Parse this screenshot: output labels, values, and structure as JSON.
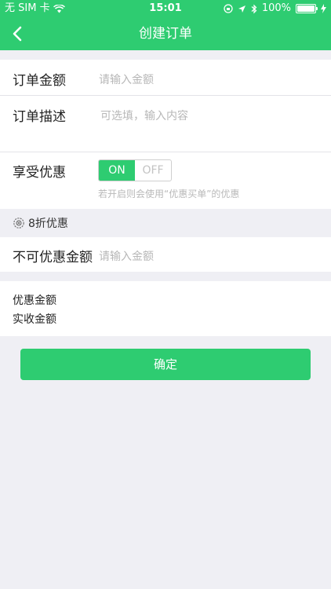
{
  "status_bar": {
    "carrier": "无 SIM 卡",
    "time": "15:01",
    "battery": "100%"
  },
  "nav": {
    "title": "创建订单"
  },
  "form": {
    "amount_label": "订单金额",
    "amount_placeholder": "请输入金额",
    "description_label": "订单描述",
    "description_placeholder": "可选填，输入内容",
    "discount_label": "享受优惠",
    "toggle_on": "ON",
    "toggle_off": "OFF",
    "discount_hint": "若开启则会使用“优惠买单”的优惠",
    "discount_type": "8折优惠",
    "non_discount_label": "不可优惠金额",
    "non_discount_placeholder": "请输入金额"
  },
  "summary": {
    "discount_amount_label": "优惠金额",
    "received_amount_label": "实收金额"
  },
  "actions": {
    "confirm_label": "确定"
  },
  "colors": {
    "accent": "#2ecc71",
    "background": "#efeff4"
  }
}
